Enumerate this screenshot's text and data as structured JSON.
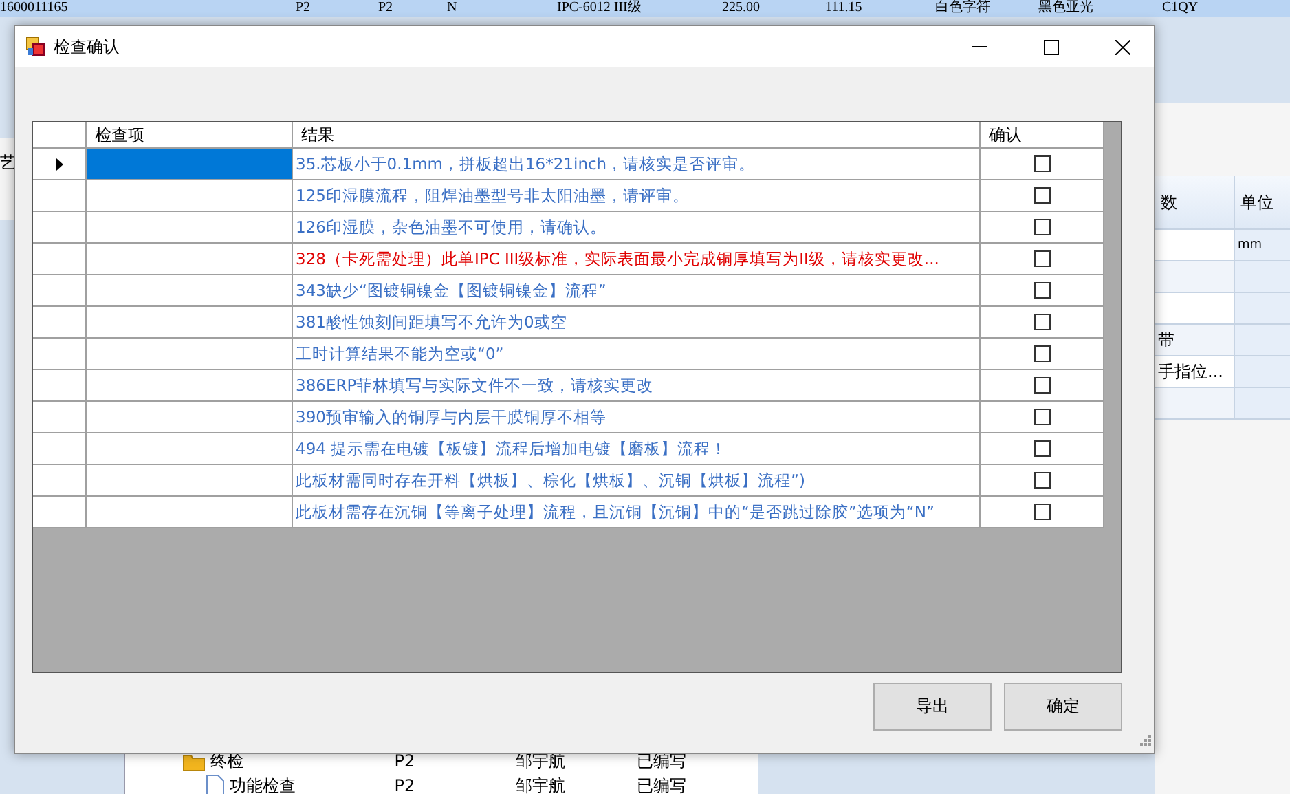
{
  "background_top_row": {
    "cells": [
      "1600011165",
      "P2",
      "P2",
      "N",
      "IPC-6012 III级",
      "225.00",
      "111.15",
      "白色字符",
      "黑色亚光",
      "C1QY"
    ]
  },
  "background_left": {
    "label": "艺"
  },
  "background_right_table": {
    "columns": [
      "数",
      "单位"
    ],
    "rows": [
      {
        "column_1": "",
        "column_2": "mm"
      },
      {
        "column_1": "",
        "column_2": ""
      },
      {
        "column_1": "",
        "column_2": ""
      },
      {
        "column_1": "带",
        "column_2": ""
      },
      {
        "column_1": "手指位...",
        "column_2": ""
      },
      {
        "column_1": "",
        "column_2": ""
      }
    ]
  },
  "background_tree": {
    "rows": [
      {
        "kind": "folder",
        "label": "终检",
        "cells": [
          "P2",
          "邹宇航",
          "已编写"
        ]
      },
      {
        "kind": "file",
        "label": "功能检查",
        "cells": [
          "P2",
          "邹宇航",
          "已编写"
        ]
      }
    ]
  },
  "dialog": {
    "title": "检查确认",
    "grid": {
      "columns": [
        "检查项",
        "结果",
        "确认"
      ],
      "rows": [
        {
          "selected": true,
          "result": "35.芯板小于0.1mm，拼板超出16*21inch，请核实是否评审。",
          "color": "#3a6fc4",
          "checked": false
        },
        {
          "selected": false,
          "result": "125印湿膜流程，阻焊油墨型号非太阳油墨，请评审。",
          "color": "#3a6fc4",
          "checked": false
        },
        {
          "selected": false,
          "result": "126印湿膜，杂色油墨不可使用，请确认。",
          "color": "#3a6fc4",
          "checked": false
        },
        {
          "selected": false,
          "result": "328（卡死需处理）此单IPC III级标准，实际表面最小完成铜厚填写为II级，请核实更改...",
          "color": "#e00000",
          "checked": false
        },
        {
          "selected": false,
          "result": "343缺少“图镀铜镍金【图镀铜镍金】流程”",
          "color": "#3a6fc4",
          "checked": false
        },
        {
          "selected": false,
          "result": "381酸性蚀刻间距填写不允许为0或空",
          "color": "#3a6fc4",
          "checked": false
        },
        {
          "selected": false,
          "result": "工时计算结果不能为空或“0”",
          "color": "#3a6fc4",
          "checked": false
        },
        {
          "selected": false,
          "result": "386ERP菲林填写与实际文件不一致，请核实更改",
          "color": "#3a6fc4",
          "checked": false
        },
        {
          "selected": false,
          "result": "390预审输入的铜厚与内层干膜铜厚不相等",
          "color": "#3a6fc4",
          "checked": false
        },
        {
          "selected": false,
          "result": "494 提示需在电镀【板镀】流程后增加电镀【磨板】流程！",
          "color": "#3a6fc4",
          "checked": false
        },
        {
          "selected": false,
          "result": "此板材需同时存在开料【烘板】、棕化【烘板】、沉铜【烘板】流程”)",
          "color": "#3a6fc4",
          "checked": false
        },
        {
          "selected": false,
          "result": "此板材需存在沉铜【等离子处理】流程，且沉铜【沉铜】中的“是否跳过除胶”选项为“N”",
          "color": "#3a6fc4",
          "checked": false
        }
      ]
    },
    "buttons": [
      "导出",
      "确定"
    ]
  }
}
